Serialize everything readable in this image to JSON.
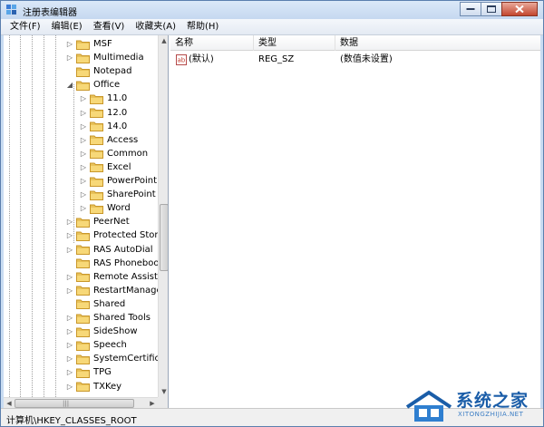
{
  "window": {
    "title": "注册表编辑器"
  },
  "menu": [
    "文件(F)",
    "编辑(E)",
    "查看(V)",
    "收藏夹(A)",
    "帮助(H)"
  ],
  "tree": {
    "items": [
      {
        "label": "MSF",
        "expander": "▷"
      },
      {
        "label": "Multimedia",
        "expander": "▷"
      },
      {
        "label": "Notepad",
        "expander": ""
      },
      {
        "label": "Office",
        "expander": "◢"
      },
      {
        "label": "11.0",
        "expander": "▷"
      },
      {
        "label": "12.0",
        "expander": "▷"
      },
      {
        "label": "14.0",
        "expander": "▷"
      },
      {
        "label": "Access",
        "expander": "▷"
      },
      {
        "label": "Common",
        "expander": "▷"
      },
      {
        "label": "Excel",
        "expander": "▷"
      },
      {
        "label": "PowerPoint",
        "expander": "▷"
      },
      {
        "label": "SharePoint D",
        "expander": "▷"
      },
      {
        "label": "Word",
        "expander": "▷"
      },
      {
        "label": "PeerNet",
        "expander": "▷"
      },
      {
        "label": "Protected Storag",
        "expander": "▷"
      },
      {
        "label": "RAS AutoDial",
        "expander": "▷"
      },
      {
        "label": "RAS Phonebook",
        "expander": ""
      },
      {
        "label": "Remote Assistan",
        "expander": "▷"
      },
      {
        "label": "RestartManager",
        "expander": "▷"
      },
      {
        "label": "Shared",
        "expander": ""
      },
      {
        "label": "Shared Tools",
        "expander": "▷"
      },
      {
        "label": "SideShow",
        "expander": "▷"
      },
      {
        "label": "Speech",
        "expander": "▷"
      },
      {
        "label": "SystemCertificate",
        "expander": "▷"
      },
      {
        "label": "TPG",
        "expander": "▷"
      },
      {
        "label": "TXKey",
        "expander": "▷"
      }
    ],
    "hscroll_grip": "|||"
  },
  "list": {
    "columns": [
      "名称",
      "类型",
      "数据"
    ],
    "rows": [
      {
        "name": "(默认)",
        "type": "REG_SZ",
        "data": "(数值未设置)"
      }
    ]
  },
  "status": {
    "path": "计算机\\HKEY_CLASSES_ROOT"
  },
  "watermark": {
    "title": "系统之家",
    "url": "XITONGZHIJIA.NET"
  },
  "colors": {
    "folder": "#e8c25a",
    "folder_dark": "#c9972a",
    "brand_blue": "#1a5da8"
  }
}
